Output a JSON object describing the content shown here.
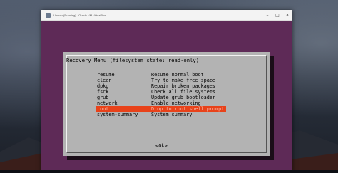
{
  "window": {
    "title": "Ubuntu (Running) - Oracle VM VirtualBox",
    "minimize_icon": "minimize-icon",
    "maximize_icon": "maximize-icon",
    "close_icon": "close-icon"
  },
  "dialog": {
    "title": "Recovery Menu (filesystem state: read-only)",
    "items": [
      {
        "key": "resume",
        "desc": "Resume normal boot"
      },
      {
        "key": "clean",
        "desc": "Try to make free space"
      },
      {
        "key": "dpkg",
        "desc": "Repair broken packages"
      },
      {
        "key": "fsck",
        "desc": "Check all file systems"
      },
      {
        "key": "grub",
        "desc": "Update grub bootloader"
      },
      {
        "key": "network",
        "desc": "Enable networking"
      },
      {
        "key": "root",
        "desc": "Drop to root shell prompt"
      },
      {
        "key": "system-summary",
        "desc": "System summary"
      }
    ],
    "selected_index": 6,
    "ok_label": "<Ok>"
  },
  "colors": {
    "screen_bg": "#5e2a57",
    "dialog_bg": "#b3b3b3",
    "selection": "#e8421a"
  }
}
